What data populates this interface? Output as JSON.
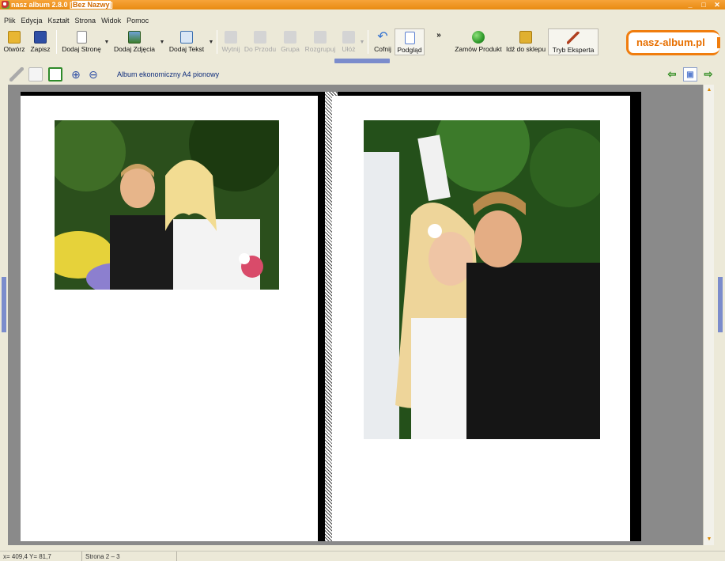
{
  "window": {
    "app_title": "nasz album 2.8.0",
    "document": "Bez Nazwy",
    "controls": [
      "_",
      "□",
      "✕"
    ]
  },
  "menu": [
    "Plik",
    "Edycja",
    "Kształt",
    "Strona",
    "Widok",
    "Pomoc"
  ],
  "toolbar": {
    "buttons": [
      {
        "label": "Otwórz",
        "icon": "folder-open-icon",
        "color": "#e8b632",
        "enabled": true
      },
      {
        "label": "Zapisz",
        "icon": "floppy-disk-icon",
        "color": "#2f4fa5",
        "enabled": true
      },
      {
        "label": "Dodaj Stronę",
        "icon": "new-page-icon",
        "color": "#ffffff",
        "enabled": true,
        "dropdown": true
      },
      {
        "label": "Dodaj Zdjęcia",
        "icon": "add-photo-icon",
        "color": "#3e7f2e",
        "enabled": true,
        "dropdown": true
      },
      {
        "label": "Dodaj Tekst",
        "icon": "add-text-icon",
        "color": "#3b6fb0",
        "enabled": true,
        "dropdown": true
      },
      {
        "label": "Wytnij",
        "icon": "cut-icon",
        "color": "#c8c8c8",
        "enabled": false
      },
      {
        "label": "Do Przodu",
        "icon": "bring-forward-icon",
        "color": "#c8c8c8",
        "enabled": false
      },
      {
        "label": "Grupa",
        "icon": "group-icon",
        "color": "#c8c8c8",
        "enabled": false
      },
      {
        "label": "Rozgrupuj",
        "icon": "ungroup-icon",
        "color": "#c8c8c8",
        "enabled": false
      },
      {
        "label": "Ułóż",
        "icon": "arrange-icon",
        "color": "#c8c8c8",
        "enabled": false,
        "dropdown": true
      },
      {
        "label": "Cofnij",
        "icon": "undo-icon",
        "color": "#2f6fd0",
        "enabled": true
      },
      {
        "label": "Podgląd",
        "icon": "preview-icon",
        "color": "#5a7fd0",
        "enabled": true,
        "pressed": true
      },
      {
        "label": "Zamów Produkt",
        "icon": "globe-icon",
        "color": "#2f9a2a",
        "enabled": true
      },
      {
        "label": "Idź do sklepu",
        "icon": "shop-icon",
        "color": "#e0b030",
        "enabled": true
      },
      {
        "label": "Tryb Eksperta",
        "icon": "magic-wand-icon",
        "color": "#d0a040",
        "enabled": true,
        "pressed": true
      }
    ],
    "more": "»",
    "brand": "nasz-album.pl"
  },
  "toolbar2": {
    "album_name": "Album ekonomiczny A4 pionowy",
    "tools": [
      "pencil-icon",
      "frame-icon",
      "page-icon",
      "zoom-in-icon",
      "zoom-out-icon"
    ],
    "nav": [
      "arrow-left-icon",
      "page-preview-icon",
      "arrow-right-icon"
    ]
  },
  "status": {
    "coords": "x= 409,4  Y= 81,7",
    "pages": "Strona 2 – 3"
  },
  "colors": {
    "accent": "#f07d0e",
    "titlebar": "#e88a12",
    "workspace": "#8a8a8a"
  }
}
